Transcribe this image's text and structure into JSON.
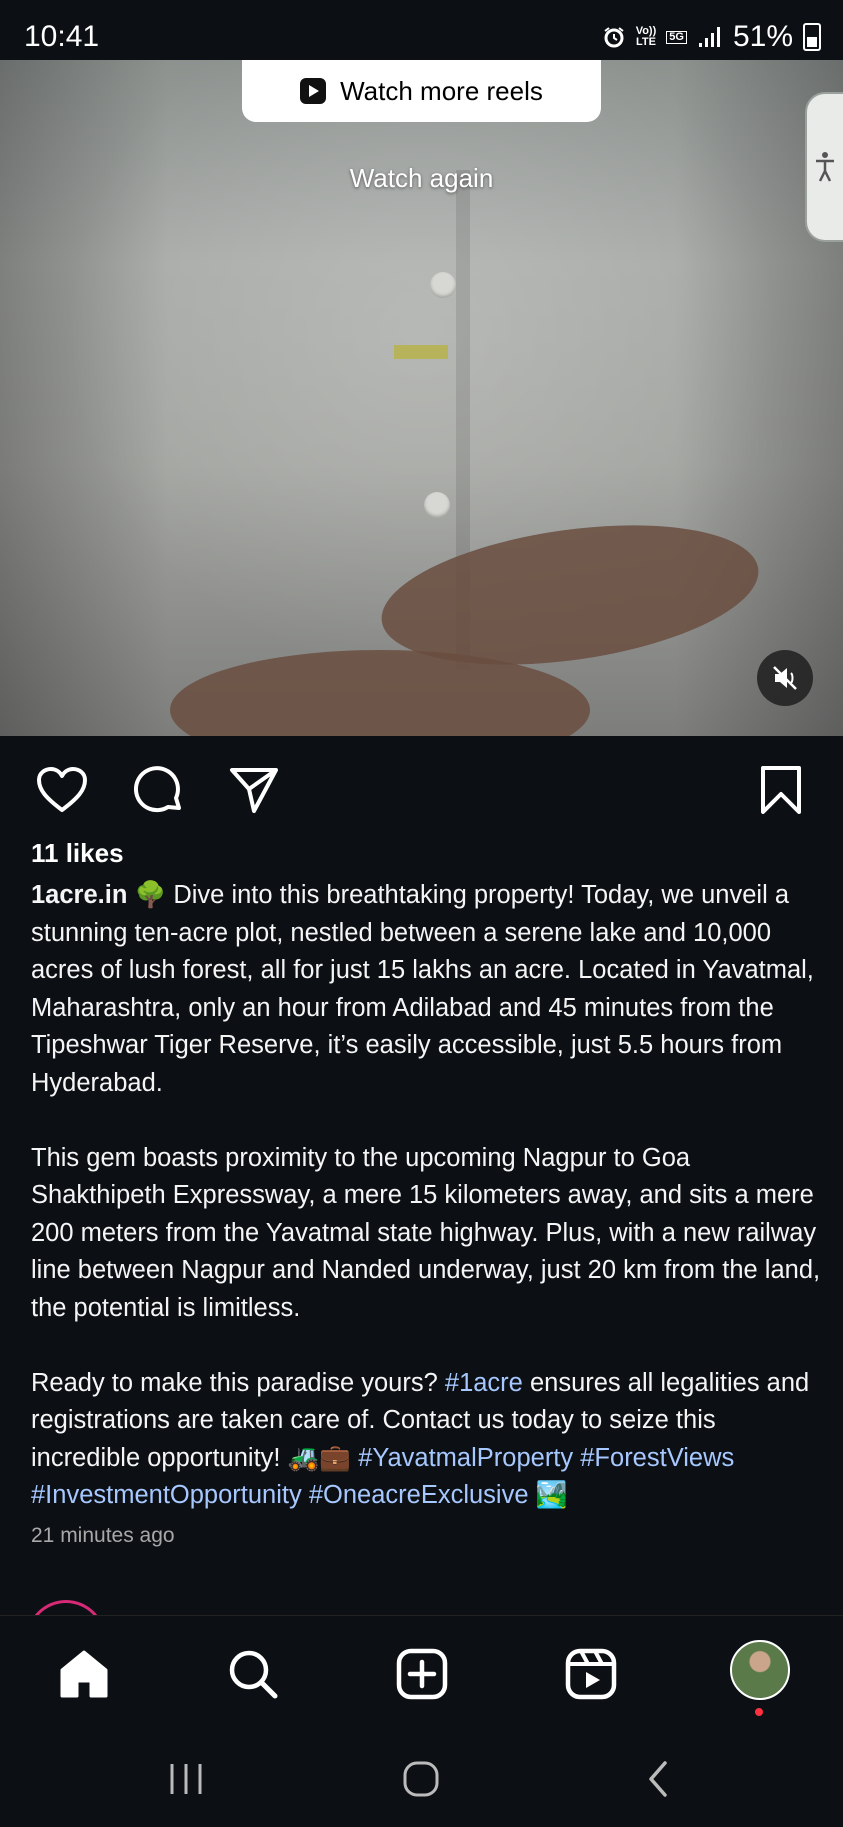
{
  "status_bar": {
    "time": "10:41",
    "volte_top": "Vo))",
    "volte_bottom": "LTE",
    "network": "5G",
    "battery": "51%"
  },
  "video": {
    "watch_more_label": "Watch more reels",
    "watch_again_label": "Watch again",
    "muted": true
  },
  "post": {
    "likes": "11 likes",
    "username": "1acre.in",
    "caption_p1_emoji": "🌳",
    "caption_p1": " Dive into this breathtaking property! Today, we unveil a stunning ten-acre plot, nestled between a serene lake and 10,000 acres of lush forest, all for just 15 lakhs an acre. Located in Yavatmal, Maharashtra, only an hour from Adilabad and 45 minutes from the Tipeshwar Tiger Reserve, it’s easily accessible, just 5.5 hours from Hyderabad.",
    "caption_p2": "This gem boasts proximity to the upcoming Nagpur to Goa Shakthipeth Expressway, a mere 15 kilometers away, and sits a mere 200 meters from the Yavatmal state highway. Plus, with a new railway line between Nagpur and Nanded underway, just 20 km from the land, the potential is limitless.",
    "caption_p3_a": "Ready to make this paradise yours? ",
    "hashtag_1acre": "#1acre",
    "caption_p3_b": " ensures all legalities and registrations are taken care of. Contact us today to seize this incredible opportunity! ",
    "caption_p3_emojis": "🚜💼",
    "hashtag_yavatmal": "#YavatmalProperty",
    "hashtag_forest": "#ForestViews",
    "hashtag_investment": "#InvestmentOpportunity",
    "hashtag_oneacre": "#OneacreExclusive",
    "caption_end_emoji": "🏞️",
    "timestamp": "21 minutes ago"
  },
  "icons": {
    "like": "heart-icon",
    "comment": "comment-icon",
    "share": "send-icon",
    "save": "bookmark-icon",
    "home": "home-icon",
    "search": "search-icon",
    "create": "plus-square-icon",
    "reels": "reels-icon",
    "profile": "profile-avatar",
    "accessibility": "accessibility-icon",
    "mute": "speaker-muted-icon"
  },
  "colors": {
    "background": "#0c0f14",
    "hashtag": "#a6c8ff",
    "notification_dot": "#ff3040"
  }
}
